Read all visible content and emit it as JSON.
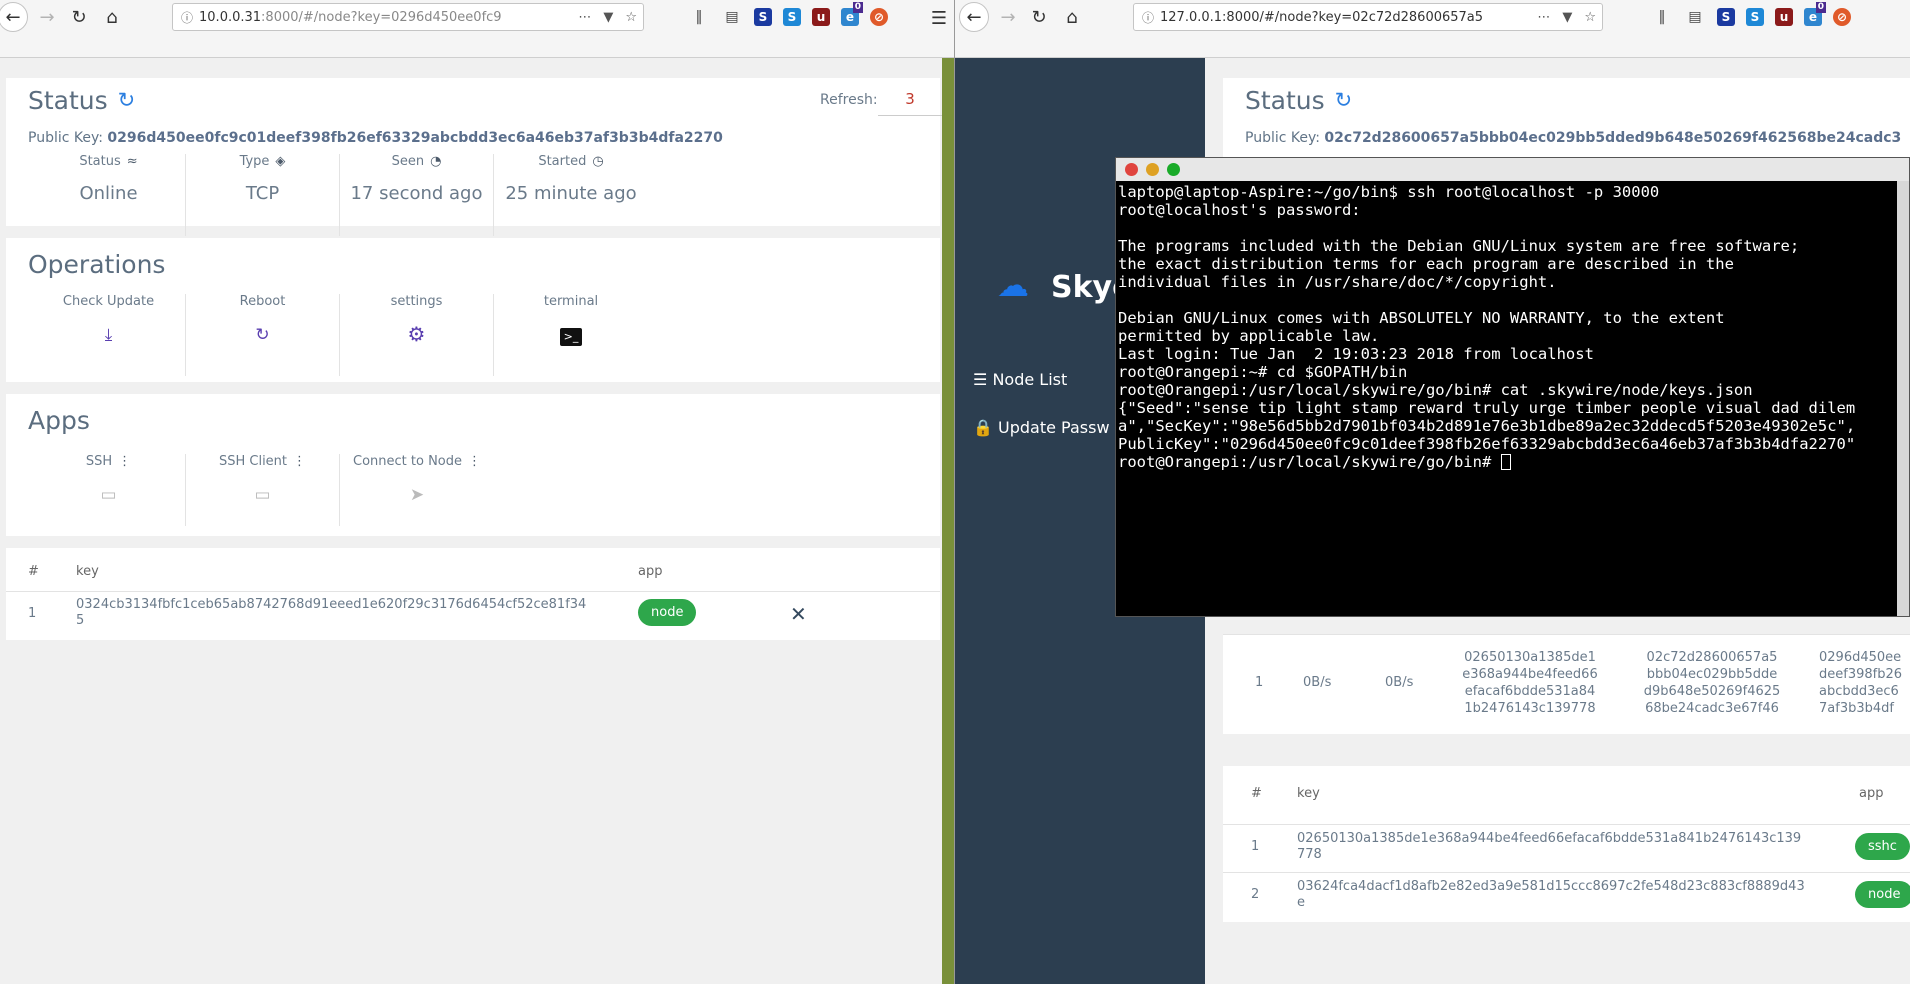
{
  "left_browser": {
    "url_host": "10.0.0.31",
    "url_rest": ":8000/#/node?key=0296d450ee0fc9",
    "status": {
      "title": "Status",
      "public_key_label": "Public Key:",
      "public_key": "0296d450ee0fc9c01deef398fb26ef63329abcbdd3ec6a46eb37af3b3b4dfa2270",
      "refresh_label": "Refresh:",
      "refresh_value": "3",
      "cells": [
        {
          "label": "Status",
          "value": "Online"
        },
        {
          "label": "Type",
          "value": "TCP"
        },
        {
          "label": "Seen",
          "value": "17 second ago"
        },
        {
          "label": "Started",
          "value": "25 minute ago"
        }
      ]
    },
    "operations": {
      "title": "Operations",
      "items": [
        {
          "label": "Check Update"
        },
        {
          "label": "Reboot"
        },
        {
          "label": "settings"
        },
        {
          "label": "terminal"
        }
      ]
    },
    "apps": {
      "title": "Apps",
      "items": [
        {
          "label": "SSH"
        },
        {
          "label": "SSH Client"
        },
        {
          "label": "Connect to Node"
        }
      ]
    },
    "table": {
      "headers": [
        "#",
        "key",
        "app"
      ],
      "rows": [
        {
          "index": "1",
          "key_a": "0324cb3134fbfc1ceb65ab8742768d91eeed1e620f29c3176d6454cf52ce81f34",
          "key_b": "5",
          "app": "node"
        }
      ]
    }
  },
  "right_browser": {
    "url_host": "127.0.0.1",
    "url_rest": ":8000/#/node?key=02c72d28600657a5",
    "sidebar": {
      "brand": "Skyc",
      "items": [
        {
          "label": "Node List"
        },
        {
          "label": "Update Passw"
        }
      ]
    },
    "status": {
      "title": "Status",
      "public_key_label": "Public Key:",
      "public_key": "02c72d28600657a5bbb04ec029bb5dded9b648e50269f462568be24cadc3"
    },
    "conn_table": {
      "row": {
        "index": "1",
        "up": "0B/s",
        "down": "0B/s",
        "k1": [
          "02650130a1385de1",
          "e368a944be4feed66",
          "efacaf6bdde531a84",
          "1b2476143c139778"
        ],
        "k2": [
          "02c72d28600657a5",
          "bbb04ec029bb5dde",
          "d9b648e50269f4625",
          "68be24cadc3e67f46"
        ],
        "k3": [
          "0296d450ee",
          "deef398fb26",
          "abcbdd3ec6",
          "7af3b3b4df"
        ]
      }
    },
    "app_table": {
      "headers": [
        "#",
        "key",
        "app"
      ],
      "rows": [
        {
          "index": "1",
          "key_a": "02650130a1385de1e368a944be4feed66efacaf6bdde531a841b2476143c139",
          "key_b": "778",
          "app": "sshc"
        },
        {
          "index": "2",
          "key_a": "03624fca4dacf1d8afb2e82ed3a9e581d15ccc8697c2fe548d23c883cf8889d43",
          "key_b": "e",
          "app": "node"
        }
      ]
    }
  },
  "terminal": {
    "lines": [
      "laptop@laptop-Aspire:~/go/bin$ ssh root@localhost -p 30000",
      "root@localhost's password:",
      "",
      "The programs included with the Debian GNU/Linux system are free software;",
      "the exact distribution terms for each program are described in the",
      "individual files in /usr/share/doc/*/copyright.",
      "",
      "Debian GNU/Linux comes with ABSOLUTELY NO WARRANTY, to the extent",
      "permitted by applicable law.",
      "Last login: Tue Jan  2 19:03:23 2018 from localhost",
      "root@Orangepi:~# cd $GOPATH/bin",
      "root@Orangepi:/usr/local/skywire/go/bin# cat .skywire/node/keys.json",
      "{\"Seed\":\"sense tip light stamp reward truly urge timber people visual dad dilem",
      "a\",\"SecKey\":\"98e56d5bb2d7901bf034b2d891e76e3b1dbe89a2ec32ddecd5f5203e49302e5c\",",
      "PublicKey\":\"0296d450ee0fc9c01deef398fb26ef63329abcbdd3ec6a46eb37af3b3b4dfa2270\""
    ],
    "prompt": "root@Orangepi:/usr/local/skywire/go/bin# "
  },
  "colors": {
    "accent": "#2c7fe0",
    "green": "#2ea74b",
    "sidebar": "#2c3e50",
    "ops_purple": "#5a3fb0"
  }
}
